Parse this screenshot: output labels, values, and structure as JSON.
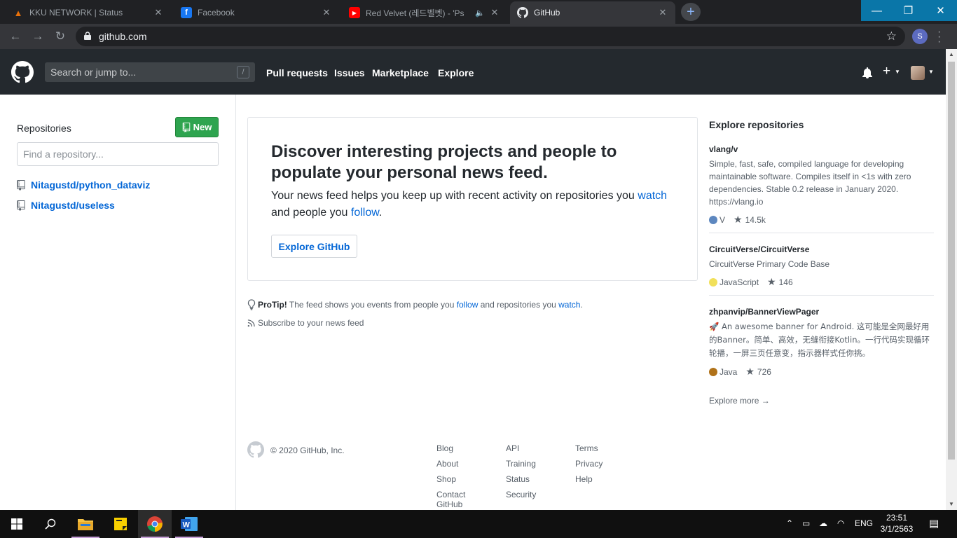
{
  "browser": {
    "tabs": [
      {
        "title": "KKU NETWORK | Status",
        "favicon_color": "#e8710a",
        "active": false
      },
      {
        "title": "Facebook",
        "favicon_color": "#1877f2",
        "active": false
      },
      {
        "title": "Red Velvet (레드벨벳) - 'Ps",
        "favicon_color": "#ff0000",
        "active": false
      },
      {
        "title": "GitHub",
        "favicon_color": "#ffffff",
        "active": true
      }
    ],
    "url": "github.com",
    "profile_initial": "S"
  },
  "header": {
    "search_placeholder": "Search or jump to...",
    "search_key": "/",
    "nav": [
      "Pull requests",
      "Issues",
      "Marketplace",
      "Explore"
    ]
  },
  "sidebar": {
    "title": "Repositories",
    "new_label": "New",
    "filter_placeholder": "Find a repository...",
    "repos": [
      "Nitagustd/python_dataviz",
      "Nitagustd/useless"
    ]
  },
  "news": {
    "heading": "Discover interesting projects and people to populate your personal news feed.",
    "text_1": "Your news feed helps you keep up with recent activity on repositories you ",
    "link_watch": "watch",
    "text_2": "and people you ",
    "link_follow": "follow",
    "text_3": ".",
    "explore_button": "Explore GitHub",
    "protip_label": "ProTip!",
    "protip_text": " The feed shows you events from people you ",
    "protip_follow": "follow",
    "protip_and": " and repositories you ",
    "protip_watch": "watch",
    "protip_end": ".",
    "subscribe": "Subscribe to your news feed"
  },
  "explore": {
    "title": "Explore repositories",
    "repos": [
      {
        "name": "vlang/v",
        "description": "Simple, fast, safe, compiled language for developing maintainable software. Compiles itself in <1s with zero dependencies. Stable 0.2 release in January 2020. https://vlang.io",
        "language": "V",
        "lang_color": "#5d87bf",
        "stars": "14.5k"
      },
      {
        "name": "CircuitVerse/CircuitVerse",
        "description": "CircuitVerse Primary Code Base",
        "language": "JavaScript",
        "lang_color": "#f1e05a",
        "stars": "146"
      },
      {
        "name": "zhpanvip/BannerViewPager",
        "description": "🚀 An awesome banner for Android. 这可能是全网最好用的Banner。简单、高效，无缝衔接Kotlin。一行代码实现循环轮播，一屏三页任意变，指示器样式任你挑。",
        "language": "Java",
        "lang_color": "#b07219",
        "stars": "726"
      }
    ],
    "more": "Explore more →"
  },
  "footer": {
    "copyright": "© 2020 GitHub, Inc.",
    "col1": [
      "Blog",
      "About",
      "Shop",
      "Contact GitHub"
    ],
    "col2": [
      "API",
      "Training",
      "Status",
      "Security"
    ],
    "col3": [
      "Terms",
      "Privacy",
      "Help"
    ]
  },
  "taskbar": {
    "language": "ENG",
    "time": "23:51",
    "date": "3/1/2563"
  }
}
